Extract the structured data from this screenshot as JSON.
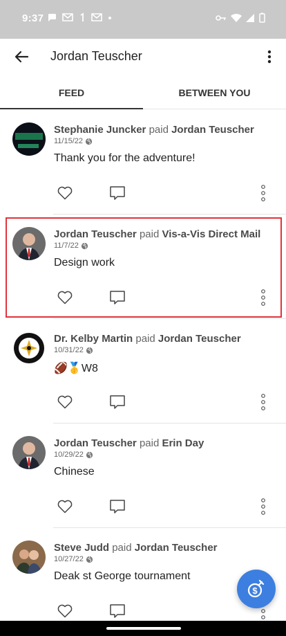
{
  "status_bar": {
    "time": "9:37",
    "left_icons": [
      "chat-bubble-icon",
      "gmail-icon",
      "one-icon",
      "gmail-icon",
      "dot-icon"
    ],
    "right_icons": [
      "vpn-key-icon",
      "wifi-icon",
      "signal-icon",
      "battery-icon"
    ]
  },
  "app_bar": {
    "title": "Jordan Teuscher",
    "back_icon": "arrow-left-icon",
    "more_icon": "more-vertical-icon"
  },
  "tabs": [
    {
      "label": "FEED",
      "active": true
    },
    {
      "label": "BETWEEN YOU",
      "active": false
    }
  ],
  "feed": [
    {
      "actor": "Stephanie Juncker",
      "verb": "paid",
      "target": "Jordan Teuscher",
      "date": "11/15/22",
      "note": "Thank you for the adventure!"
    },
    {
      "actor": "Jordan Teuscher",
      "verb": "paid",
      "target": "Vis-a-Vis Direct Mail",
      "date": "11/7/22",
      "note": "Design work"
    },
    {
      "actor": "Dr. Kelby Martin",
      "verb": "paid",
      "target": "Jordan Teuscher",
      "date": "10/31/22",
      "note": "🏈🥇W8"
    },
    {
      "actor": "Jordan Teuscher",
      "verb": "paid",
      "target": "Erin Day",
      "date": "10/29/22",
      "note": "Chinese"
    },
    {
      "actor": "Steve Judd",
      "verb": "paid",
      "target": "Jordan Teuscher",
      "date": "10/27/22",
      "note": "Deak st George tournament"
    }
  ],
  "fab": {
    "icon": "pay-request-icon"
  },
  "colors": {
    "accent": "#3d7fe0",
    "highlight": "#e0333a",
    "status_bar": "#c9c9c9"
  }
}
